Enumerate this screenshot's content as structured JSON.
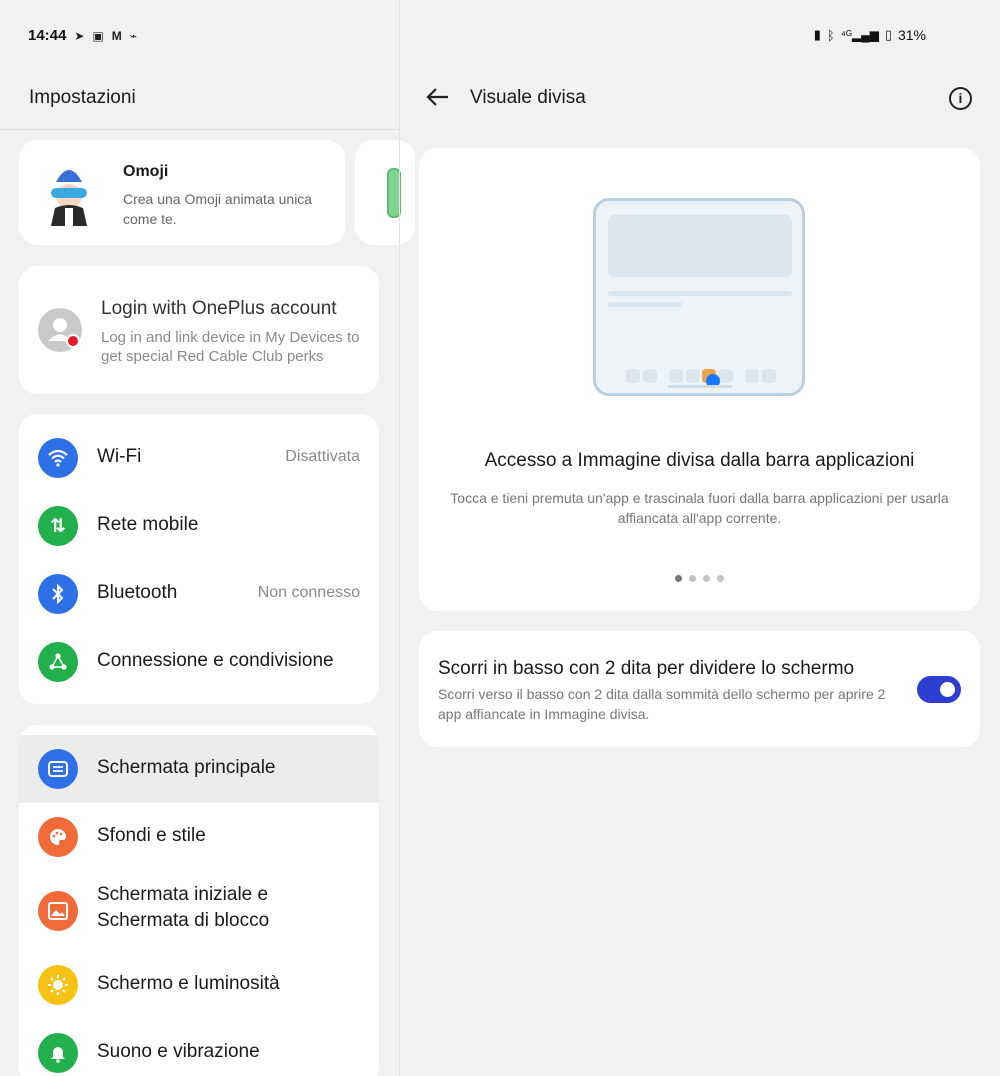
{
  "status_bar": {
    "time": "14:44",
    "left_icons": [
      "telegram-icon",
      "camera-icon",
      "gmail-icon",
      "data-saver-icon"
    ],
    "battery": "31%",
    "right_icons": [
      "vibrate-icon",
      "bluetooth-icon",
      "signal-4g-icon",
      "battery-icon"
    ]
  },
  "left": {
    "title": "Impostazioni",
    "omoji": {
      "name": "Omoji",
      "description": "Crea una Omoji animata unica come te."
    },
    "login": {
      "title": "Login with OnePlus account",
      "description": "Log in and link device in My Devices to get special Red Cable Club perks"
    },
    "network_items": [
      {
        "label": "Wi-Fi",
        "value": "Disattivata",
        "icon": "wifi-icon",
        "color": "#2f6fe8"
      },
      {
        "label": "Rete mobile",
        "value": "",
        "icon": "mobile-data-icon",
        "color": "#22b04c"
      },
      {
        "label": "Bluetooth",
        "value": "Non connesso",
        "icon": "bluetooth-icon",
        "color": "#2f6fe8"
      },
      {
        "label": "Connessione e condivisione",
        "value": "",
        "icon": "share-icon",
        "color": "#22b04c"
      }
    ],
    "settings_items": [
      {
        "label": "Schermata principale",
        "icon": "home-screen-icon",
        "color": "#2f6fe8"
      },
      {
        "label": "Sfondi e stile",
        "icon": "palette-icon",
        "color": "#f06a3a"
      },
      {
        "label": "Schermata iniziale e Schermata di blocco",
        "icon": "lockscreen-icon",
        "color": "#f06a3a"
      },
      {
        "label": "Schermo e luminosità",
        "icon": "brightness-icon",
        "color": "#f5c215"
      },
      {
        "label": "Suono e vibrazione",
        "icon": "bell-icon",
        "color": "#22b04c"
      }
    ]
  },
  "right": {
    "title": "Visuale divisa",
    "illustration": {
      "title": "Accesso a Immagine divisa dalla barra applicazioni",
      "description": "Tocca e tieni premuta un'app e trascinala fuori dalla barra applicazioni per usarla affiancata all'app corrente.",
      "page_count": 4,
      "current_page": 1
    },
    "toggle": {
      "title": "Scorri in basso con 2 dita per dividere lo schermo",
      "description": "Scorri verso il basso con 2 dita dalla sommità dello schermo per aprire 2 app affiancate in Immagine divisa.",
      "enabled": true,
      "accent": "#2d3fd1"
    }
  }
}
